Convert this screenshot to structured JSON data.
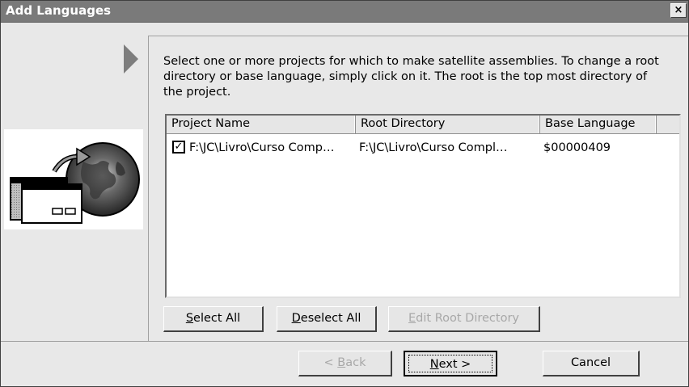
{
  "window": {
    "title": "Add Languages",
    "close_glyph": "×"
  },
  "instruction": "Select one or more projects for which to make satellite assemblies. To change a root directory or base language, simply click on it. The root is the top most directory of the project.",
  "list": {
    "columns": [
      "Project Name",
      "Root Directory",
      "Base Language"
    ],
    "rows": [
      {
        "checked": true,
        "check_glyph": "✓",
        "project": "F:\\JC\\Livro\\Curso Comp…",
        "root": "F:\\JC\\Livro\\Curso Compl…",
        "base": "$00000409"
      }
    ]
  },
  "buttons": {
    "select_all": {
      "accel": "S",
      "rest": "elect All"
    },
    "deselect_all": {
      "accel": "D",
      "rest": "eselect All"
    },
    "edit_root": {
      "accel": "E",
      "rest": "dit Root Directory",
      "enabled": false
    },
    "back": {
      "pre": "< ",
      "accel": "B",
      "rest": "ack",
      "enabled": false
    },
    "next": {
      "accel": "N",
      "rest": "ext >"
    },
    "cancel": "Cancel"
  },
  "icons": {
    "side_arrow": "arrow-right-icon",
    "illustration": "globe-window-icon"
  },
  "colors": {
    "title_bar": "#7a7a7a",
    "dialog_bg": "#e8e8e8",
    "arrow": "#7d7d7d"
  }
}
